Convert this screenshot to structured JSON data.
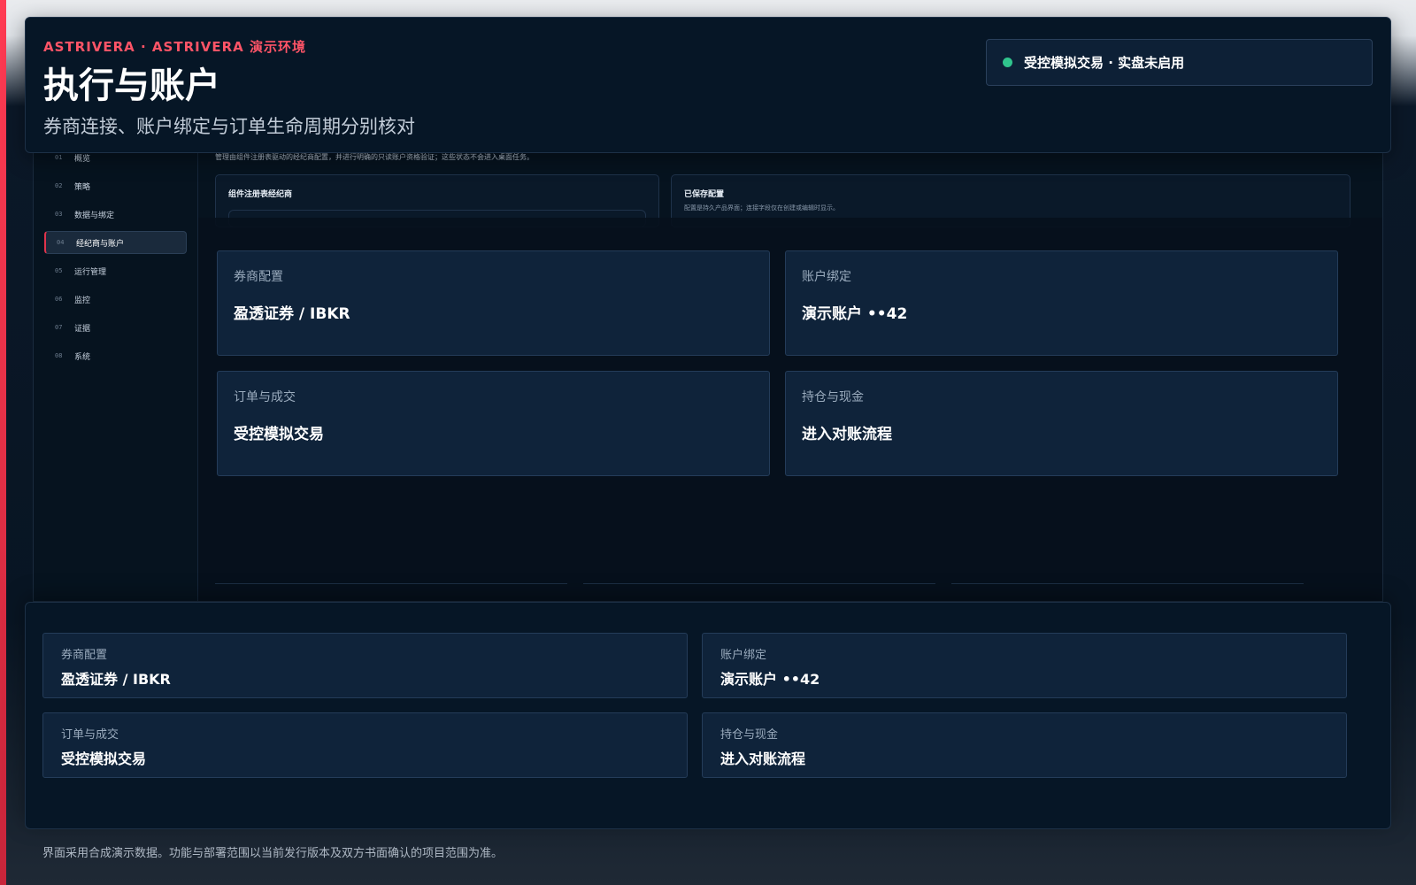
{
  "header": {
    "brand": "ASTRIVERA · ASTRIVERA 演示环境",
    "title": "执行与账户",
    "subtitle": "券商连接、账户绑定与订单生命周期分别核对",
    "status": "受控模拟交易 · 实盘未启用"
  },
  "sidebar": {
    "items": [
      {
        "num": "01",
        "label": "概览"
      },
      {
        "num": "02",
        "label": "策略"
      },
      {
        "num": "03",
        "label": "数据与绑定"
      },
      {
        "num": "04",
        "label": "经纪商与账户"
      },
      {
        "num": "05",
        "label": "运行管理"
      },
      {
        "num": "06",
        "label": "监控"
      },
      {
        "num": "07",
        "label": "证据"
      },
      {
        "num": "08",
        "label": "系统"
      }
    ]
  },
  "app": {
    "description": "管理由组件注册表驱动的经纪商配置，并进行明确的只读账户资格验证；这些状态不会进入桌面任务。",
    "registry_card_title": "组件注册表经纪商",
    "saved_card_title": "已保存配置",
    "saved_card_subtitle": "配置是持久产品界面；连接字段仅在创建或编辑时显示。"
  },
  "cards": [
    {
      "label": "券商配置",
      "value": "盈透证券 / IBKR"
    },
    {
      "label": "账户绑定",
      "value": "演示账户 ••42"
    },
    {
      "label": "订单与成交",
      "value": "受控模拟交易"
    },
    {
      "label": "持仓与现金",
      "value": "进入对账流程"
    }
  ],
  "footnote": "界面采用合成演示数据。功能与部署范围以当前发行版本及双方书面确认的项目范围为准。",
  "colors": {
    "accent": "#e0334b",
    "brand": "#ff5467",
    "status_ok": "#30c48d",
    "panel": "#061626",
    "card": "#0f233a"
  }
}
